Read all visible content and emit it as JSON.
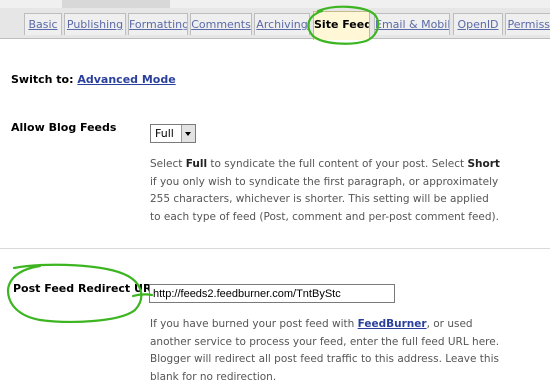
{
  "tabs": [
    {
      "label": "Basic"
    },
    {
      "label": "Publishing"
    },
    {
      "label": "Formatting"
    },
    {
      "label": "Comments"
    },
    {
      "label": "Archiving"
    },
    {
      "label": "Site Feed"
    },
    {
      "label": "Email & Mobile"
    },
    {
      "label": "OpenID"
    },
    {
      "label": "Permissions"
    }
  ],
  "switch": {
    "label": "Switch to:",
    "link": "Advanced Mode"
  },
  "allow_feeds": {
    "label": "Allow Blog Feeds",
    "selected": "Full",
    "help": {
      "part1": "Select ",
      "bold1": "Full",
      "part2": " to syndicate the full content of your post. Select ",
      "bold2": "Short",
      "part3": " if you only wish to syndicate the first paragraph, or approximately 255 characters, whichever is shorter. This setting will be applied to each type of feed (Post, comment and per-post comment feed)."
    }
  },
  "redirect": {
    "label": "Post Feed Redirect URL",
    "value": "http://feeds2.feedburner.com/TntByStc",
    "help": {
      "part1": "If you have burned your post feed with ",
      "link": "FeedBurner",
      "part2": ", or used another service to process your feed, enter the full feed URL here. Blogger will redirect all post feed traffic to this address. Leave this blank for no redirection."
    }
  },
  "annotation_color": "#3cb521",
  "active_tab_color": "#fff7d6"
}
